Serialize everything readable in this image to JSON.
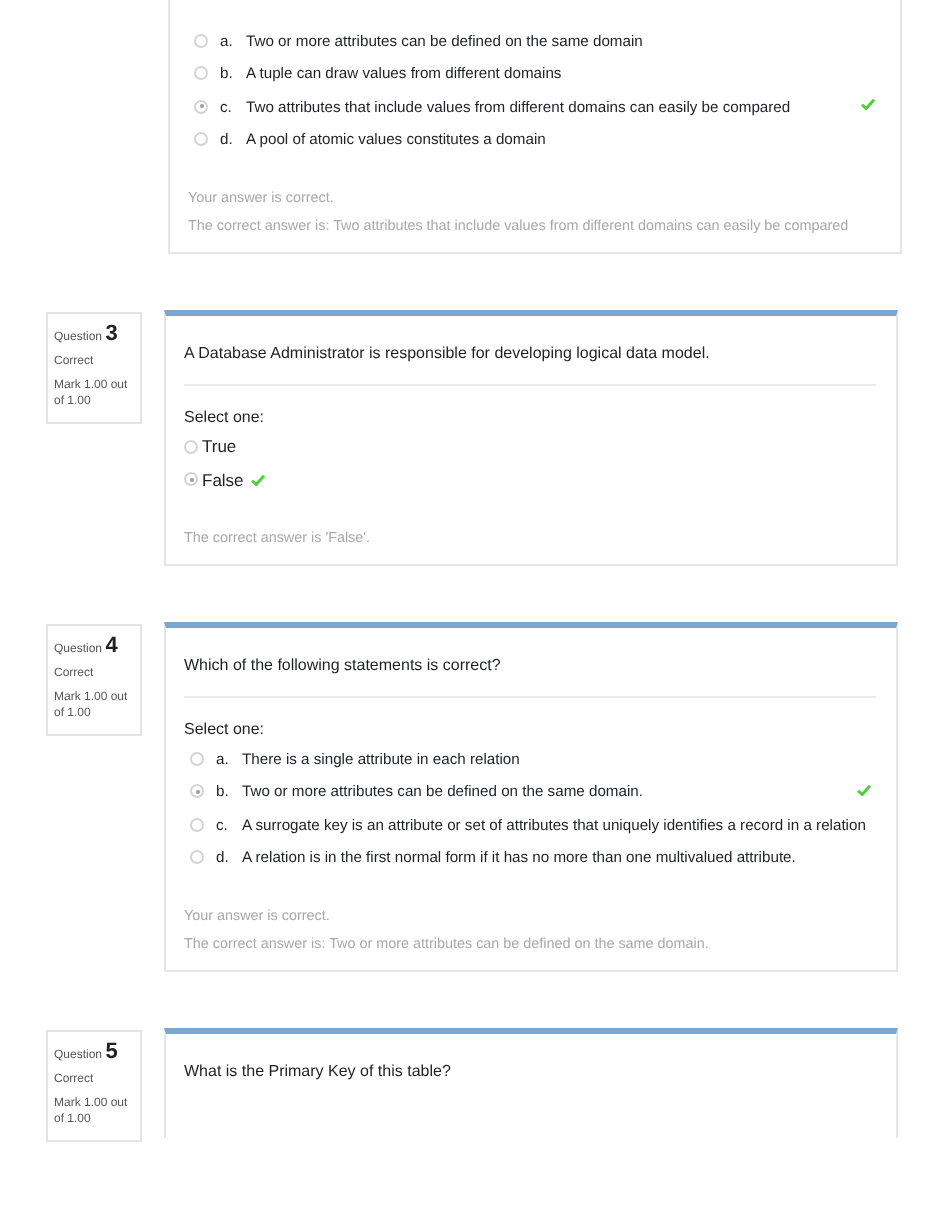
{
  "continued_question": {
    "kind": "lettered",
    "options": [
      {
        "letter": "a.",
        "text": "Two or more attributes can be defined on the same domain",
        "selected": false,
        "correct_mark": false
      },
      {
        "letter": "b.",
        "text": "A tuple can draw values from different domains",
        "selected": false,
        "correct_mark": false
      },
      {
        "letter": "c.",
        "text": "Two attributes that include values from different domains can easily be compared",
        "selected": true,
        "correct_mark": true
      },
      {
        "letter": "d.",
        "text": "A pool of atomic values constitutes a domain",
        "selected": false,
        "correct_mark": false
      }
    ],
    "feedback": [
      "Your answer is correct.",
      "The correct answer is: Two attributes that include values from different domains can easily be compared"
    ]
  },
  "questions": [
    {
      "label": "Question",
      "number": "3",
      "status": "Correct",
      "mark": "Mark 1.00 out of 1.00",
      "text": "A Database Administrator is responsible for developing logical data model.",
      "prompt": "Select one:",
      "kind": "truefalse",
      "options": [
        {
          "text": "True",
          "selected": false,
          "correct_mark": false
        },
        {
          "text": "False",
          "selected": true,
          "correct_mark": true
        }
      ],
      "feedback": [
        "The correct answer is 'False'."
      ]
    },
    {
      "label": "Question",
      "number": "4",
      "status": "Correct",
      "mark": "Mark 1.00 out of 1.00",
      "text": "Which of the following statements is correct?",
      "prompt": "Select one:",
      "kind": "lettered",
      "options": [
        {
          "letter": "a.",
          "text": "There is a single attribute in each relation",
          "selected": false,
          "correct_mark": false
        },
        {
          "letter": "b.",
          "text": "Two or more attributes can be defined on the same domain.",
          "selected": true,
          "correct_mark": true
        },
        {
          "letter": "c.",
          "text": "A surrogate key is an attribute or set of attributes that uniquely identifies a record in a relation",
          "selected": false,
          "correct_mark": false
        },
        {
          "letter": "d.",
          "text": "A relation is in the first normal form if it has no more than one multivalued attribute.",
          "selected": false,
          "correct_mark": false
        }
      ],
      "feedback": [
        "Your answer is correct.",
        "The correct answer is: Two or more attributes can be defined on the same domain."
      ]
    },
    {
      "label": "Question",
      "number": "5",
      "status": "Correct",
      "mark": "Mark 1.00 out of 1.00",
      "text": "What is the Primary Key of this table?",
      "kind": "open"
    }
  ]
}
